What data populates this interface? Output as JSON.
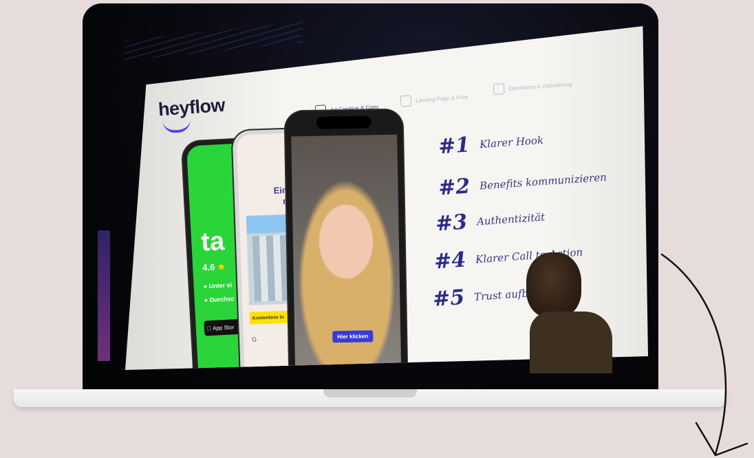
{
  "slide": {
    "brand": "heyflow",
    "steps": [
      {
        "label": "Ad Creative & Copy",
        "active": true
      },
      {
        "label": "Landing Page & Flow",
        "active": false
      },
      {
        "label": "Operations & Optimierung",
        "active": false
      }
    ],
    "points": [
      {
        "num": "#1",
        "text": "Klarer Hook"
      },
      {
        "num": "#2",
        "text": "Benefits kommunizieren"
      },
      {
        "num": "#3",
        "text": "Authentizität"
      },
      {
        "num": "#4",
        "text": "Klarer Call to Action"
      },
      {
        "num": "#5",
        "text": "Trust aufbauen"
      }
    ],
    "phones": {
      "green": {
        "big": "ta",
        "rating": "4.6",
        "line1": "Unter ei",
        "line2": "Durchsc",
        "store": "App Stor"
      },
      "house": {
        "title": "Einfach mit M",
        "cta": "Kostenlose In",
        "google": "G"
      },
      "video": {
        "cta": "Hier klicken"
      }
    }
  },
  "colors": {
    "background": "#e6dcdc",
    "accent_purple": "#5b3df2",
    "handwriting": "#2c2a8a",
    "green_phone": "#2ad53a",
    "yellow_cta": "#ffe200"
  },
  "icons": [
    "pencil-icon",
    "flow-icon",
    "gear-icon",
    "star-icon",
    "apple-icon",
    "arrow-down-icon"
  ]
}
